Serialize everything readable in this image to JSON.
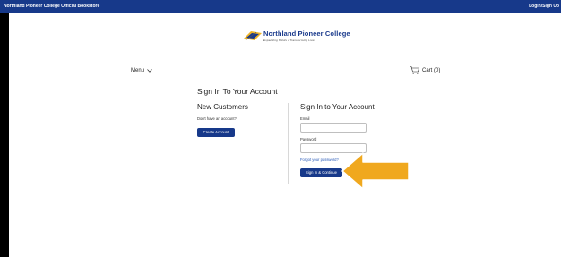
{
  "topbar": {
    "store_name": "Northland Pioneer College Official Bookstore",
    "login_label": "Login/Sign Up"
  },
  "header": {
    "logo_name": "Northland Pioneer College",
    "logo_tagline": "Expanding Minds • Transforming Lives",
    "menu_label": "Menu",
    "cart_label": "Cart (0)"
  },
  "main": {
    "title": "Sign In To Your Account",
    "new_customers": {
      "heading": "New Customers",
      "prompt": "Don't have an account?",
      "create_button": "Create Account"
    },
    "signin": {
      "heading": "Sign In to Your Account",
      "email_label": "Email",
      "email_value": "",
      "password_label": "Password",
      "password_value": "",
      "forgot_link": "Forgot your password?",
      "submit_button": "Sign In & Continue"
    }
  },
  "colors": {
    "brand": "#17398a",
    "link": "#2a5bb8",
    "callout_arrow": "#f0a81e"
  },
  "icons": [
    "chevron-down-icon",
    "cart-icon",
    "logo-emblem-icon",
    "callout-arrow-icon"
  ]
}
